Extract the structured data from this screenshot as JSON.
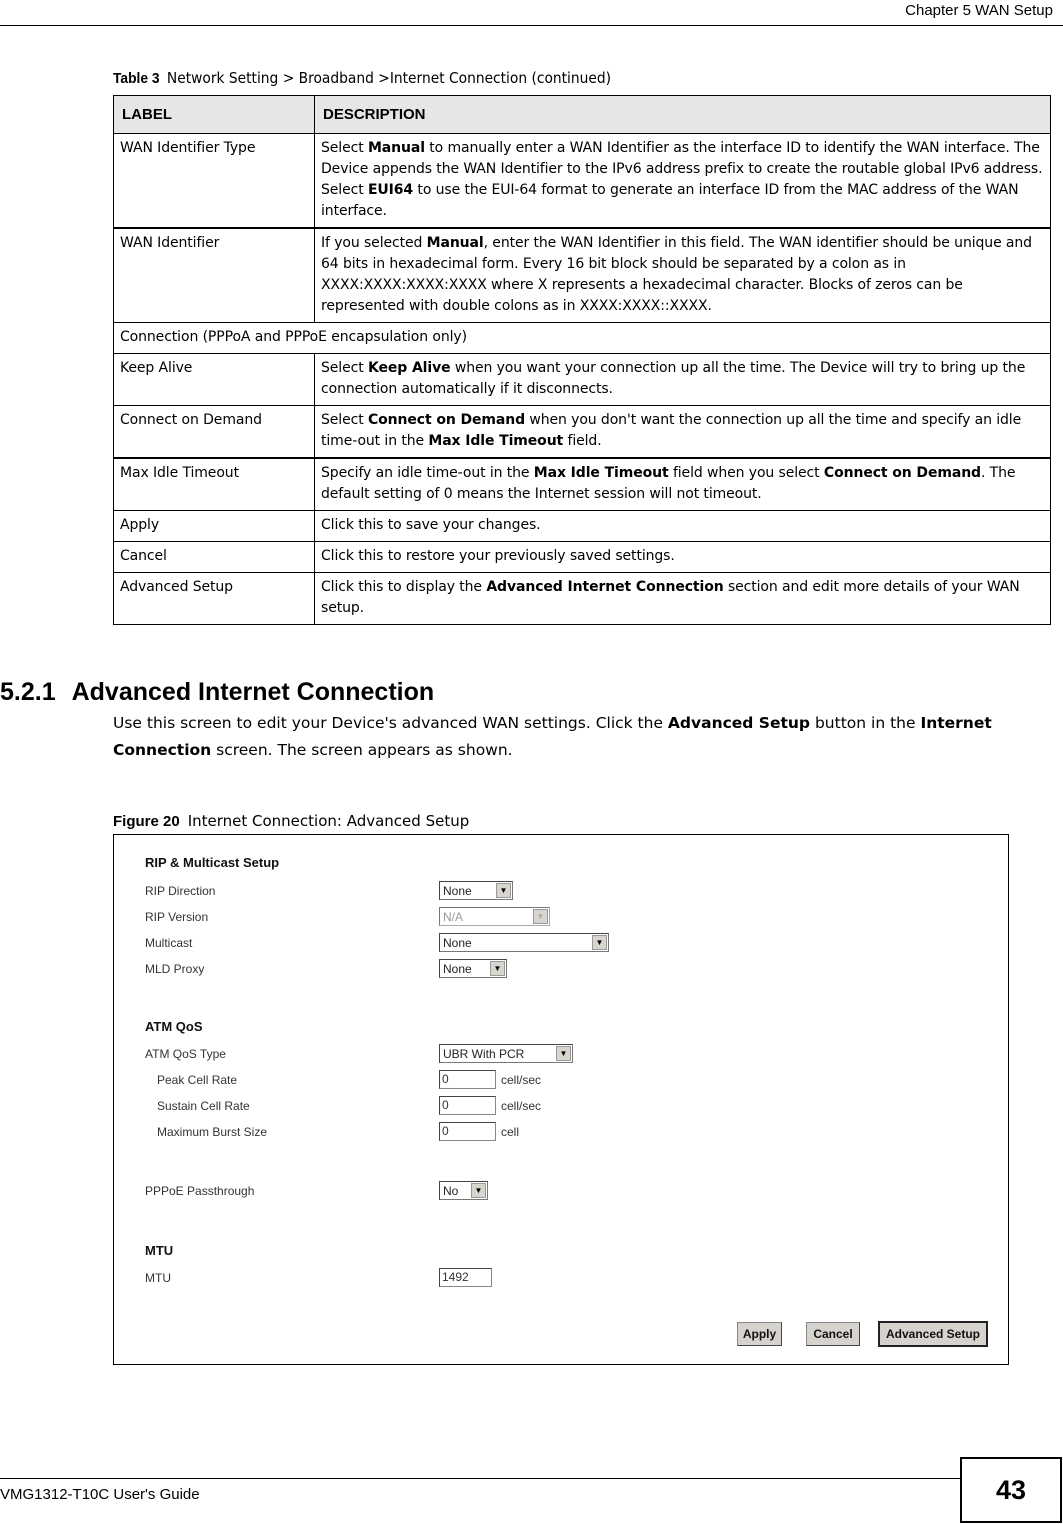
{
  "header": {
    "chapter": "Chapter 5 WAN Setup"
  },
  "table": {
    "caption_label": "Table 3",
    "caption_text": "Network Setting > Broadband >Internet Connection (continued)",
    "columns": [
      "LABEL",
      "DESCRIPTION"
    ],
    "rows": [
      {
        "label": "WAN Identifier Type",
        "description": [
          {
            "t": "Select "
          },
          {
            "b": "Manual"
          },
          {
            "t": " to manually enter a WAN Identifier as the interface ID to identify the WAN interface. The Device appends the WAN Identifier to the IPv6 address prefix to create the routable global IPv6 address. Select "
          },
          {
            "b": "EUI64"
          },
          {
            "t": " to use the EUI-64 format to generate an interface ID from the MAC address of the WAN interface."
          }
        ]
      },
      {
        "label": "WAN Identifier",
        "thick": true,
        "description": [
          {
            "t": "If you selected "
          },
          {
            "b": "Manual"
          },
          {
            "t": ", enter the WAN Identifier in this field. The WAN identifier should be unique and 64 bits in hexadecimal form. Every 16 bit block should be separated by a colon as in XXXX:XXXX:XXXX:XXXX where X represents a hexadecimal character. Blocks of zeros can be represented with double colons as in XXXX:XXXX::XXXX."
          }
        ]
      },
      {
        "label": "Connection (PPPoA and PPPoE encapsulation only)",
        "span": true
      },
      {
        "label": "Keep Alive",
        "description": [
          {
            "t": "Select "
          },
          {
            "b": "Keep Alive"
          },
          {
            "t": " when you want your connection up all the time. The Device will try to bring up the connection automatically if it disconnects."
          }
        ]
      },
      {
        "label": "Connect on Demand",
        "description": [
          {
            "t": "Select "
          },
          {
            "b": "Connect on Demand"
          },
          {
            "t": " when you don't want the connection up all the time and specify an idle time-out in the "
          },
          {
            "b": "Max Idle Timeout"
          },
          {
            "t": " field."
          }
        ]
      },
      {
        "label": "Max Idle Timeout",
        "thick": true,
        "description": [
          {
            "t": "Specify an idle time-out in the "
          },
          {
            "b": "Max Idle Timeout"
          },
          {
            "t": " field when you select "
          },
          {
            "b": "Connect on Demand"
          },
          {
            "t": ". The default setting of 0 means the Internet session will not timeout."
          }
        ]
      },
      {
        "label": "Apply",
        "description": [
          {
            "t": "Click this to save your changes."
          }
        ]
      },
      {
        "label": "Cancel",
        "description": [
          {
            "t": "Click this to restore your previously saved settings."
          }
        ]
      },
      {
        "label": "Advanced Setup",
        "description": [
          {
            "t": "Click this to display the "
          },
          {
            "b": "Advanced Internet Connection"
          },
          {
            "t": " section and edit more details of your WAN setup."
          }
        ]
      }
    ]
  },
  "section": {
    "number": "5.2.1",
    "title": "Advanced Internet Connection",
    "intro": [
      {
        "t": "Use this screen to edit your Device's advanced WAN settings. Click the "
      },
      {
        "b": "Advanced Setup"
      },
      {
        "t": " button in the "
      },
      {
        "b": "Internet Connection"
      },
      {
        "t": " screen. The screen appears as shown."
      }
    ]
  },
  "figure": {
    "caption_label": "Figure 20",
    "caption_text": "Internet Connection: Advanced Setup",
    "rip_heading": "RIP & Multicast Setup",
    "rip_direction_label": "RIP Direction",
    "rip_direction_value": "None",
    "rip_version_label": "RIP Version",
    "rip_version_value": "N/A",
    "multicast_label": "Multicast",
    "multicast_value": "None",
    "mld_proxy_label": "MLD Proxy",
    "mld_proxy_value": "None",
    "atm_heading": "ATM QoS",
    "atm_qos_type_label": "ATM QoS Type",
    "atm_qos_type_value": "UBR With PCR",
    "peak_cell_rate_label": "Peak Cell Rate",
    "peak_cell_rate_value": "0",
    "peak_cell_rate_unit": "cell/sec",
    "sustain_cell_rate_label": "Sustain Cell Rate",
    "sustain_cell_rate_value": "0",
    "sustain_cell_rate_unit": "cell/sec",
    "max_burst_size_label": "Maximum Burst Size",
    "max_burst_size_value": "0",
    "max_burst_size_unit": "cell",
    "pppoe_passthrough_label": "PPPoE Passthrough",
    "pppoe_passthrough_value": "No",
    "mtu_heading": "MTU",
    "mtu_label": "MTU",
    "mtu_value": "1492",
    "apply_label": "Apply",
    "cancel_label": "Cancel",
    "advanced_setup_label": "Advanced Setup",
    "dropdown_icon": "triangle-down"
  },
  "footer": {
    "guide": "VMG1312-T10C User's Guide",
    "page": "43"
  }
}
